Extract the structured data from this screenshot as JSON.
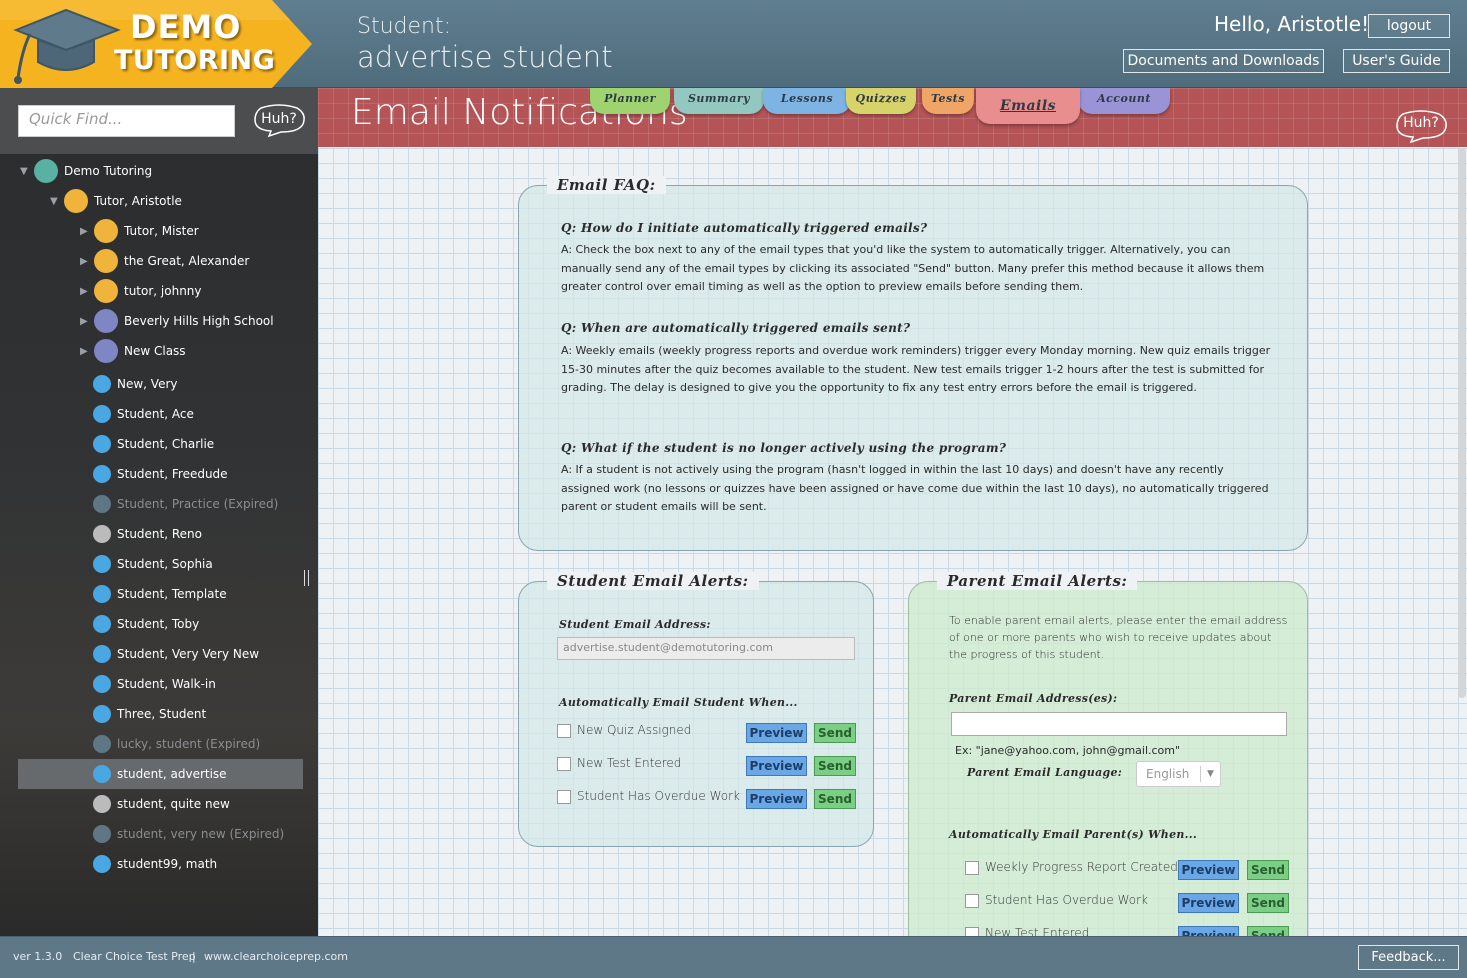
{
  "header": {
    "logo_line1": "DEMO",
    "logo_line2": "TUTORING",
    "student_label": "Student:",
    "student_name": "advertise student",
    "greeting": "Hello, Aristotle!",
    "logout_label": "logout",
    "documents_label": "Documents and Downloads",
    "guide_label": "User's Guide"
  },
  "sidebar": {
    "quick_find_placeholder": "Quick Find...",
    "help_label": "Huh?",
    "tree": [
      {
        "label": "Demo Tutoring",
        "type": "home"
      },
      {
        "label": "Tutor, Aristotle",
        "type": "tutor"
      },
      {
        "label": "Tutor, Mister",
        "type": "tutor"
      },
      {
        "label": "the Great, Alexander",
        "type": "tutor"
      },
      {
        "label": "tutor, johnny",
        "type": "tutor"
      },
      {
        "label": "Beverly Hills High School",
        "type": "school"
      },
      {
        "label": "New Class",
        "type": "school"
      },
      {
        "label": "New, Very",
        "type": "student"
      },
      {
        "label": "Student, Ace",
        "type": "student"
      },
      {
        "label": "Student, Charlie",
        "type": "student"
      },
      {
        "label": "Student, Freedude",
        "type": "student"
      },
      {
        "label": "Student, Practice  (Expired)",
        "type": "expired"
      },
      {
        "label": "Student, Reno",
        "type": "gray"
      },
      {
        "label": "Student, Sophia",
        "type": "student"
      },
      {
        "label": "Student, Template",
        "type": "student"
      },
      {
        "label": "Student, Toby",
        "type": "student"
      },
      {
        "label": "Student, Very Very New",
        "type": "student"
      },
      {
        "label": "Student, Walk-in",
        "type": "student"
      },
      {
        "label": "Three, Student",
        "type": "student"
      },
      {
        "label": "lucky, student  (Expired)",
        "type": "expired"
      },
      {
        "label": "student, advertise",
        "type": "student"
      },
      {
        "label": "student, quite new",
        "type": "gray"
      },
      {
        "label": "student, very new  (Expired)",
        "type": "expired"
      },
      {
        "label": "student99, math",
        "type": "student"
      }
    ]
  },
  "main": {
    "page_title": "Email Notifications",
    "help_label": "Huh?",
    "tabs": [
      {
        "label": "Planner",
        "color": "#9ed36f"
      },
      {
        "label": "Summary",
        "color": "#93c8c0"
      },
      {
        "label": "Lessons",
        "color": "#7eb4e4"
      },
      {
        "label": "Quizzes",
        "color": "#d8d26a"
      },
      {
        "label": "Tests",
        "color": "#eea566"
      },
      {
        "label": "Emails",
        "color": "#e88e8e"
      },
      {
        "label": "Account",
        "color": "#9a93d6"
      }
    ],
    "faq": {
      "legend": "Email FAQ:",
      "items": [
        {
          "q": "Q: How do I initiate automatically triggered emails?",
          "a": "A: Check the box next to any of the email types that you'd like the system to automatically trigger. Alternatively, you can manually send any of the email types by clicking its associated \"Send\" button.  Many prefer this method because it allows them greater control over email timing as well as the option to preview emails before sending them."
        },
        {
          "q": "Q: When are automatically triggered emails sent?",
          "a": "A: Weekly emails (weekly progress reports and overdue work reminders) trigger every Monday morning. New quiz emails trigger 15-30 minutes after the quiz becomes available to the student.  New test emails trigger 1-2 hours after the test is submitted for grading. The delay is designed to give you the opportunity to fix any test entry errors before the email is triggered."
        },
        {
          "q": "Q: What if the student is no longer actively using the program?",
          "a": "A: If a student is not actively using the program (hasn't logged in within the last 10 days) and doesn't have any recently assigned work (no lessons or quizzes have been assigned or have come due within the last 10 days), no automatically triggered parent or student emails will be sent."
        }
      ]
    },
    "student_alerts": {
      "legend": "Student Email Alerts:",
      "address_label": "Student Email Address:",
      "address_value": "advertise.student@demotutoring.com",
      "auto_label": "Automatically Email Student When...",
      "preview_label": "Preview",
      "send_label": "Send",
      "items": [
        "New Quiz Assigned",
        "New Test Entered",
        "Student Has Overdue Work"
      ]
    },
    "parent_alerts": {
      "legend": "Parent Email Alerts:",
      "note": "To enable parent email alerts, please enter the email address of one or more parents who wish to receive updates about the progress of this student.",
      "address_label": "Parent Email Address(es):",
      "example": "Ex: \"jane@yahoo.com, john@gmail.com\"",
      "language_label": "Parent Email Language:",
      "language_value": "English",
      "auto_label": "Automatically Email Parent(s) When...",
      "preview_label": "Preview",
      "send_label": "Send",
      "items": [
        "Weekly Progress Report Created",
        "Student Has Overdue Work",
        "New Test Entered"
      ]
    }
  },
  "footer": {
    "version": "ver 1.3.0",
    "company": "Clear Choice Test Prep",
    "separator": "|",
    "website": "www.clearchoiceprep.com",
    "feedback_label": "Feedback..."
  }
}
